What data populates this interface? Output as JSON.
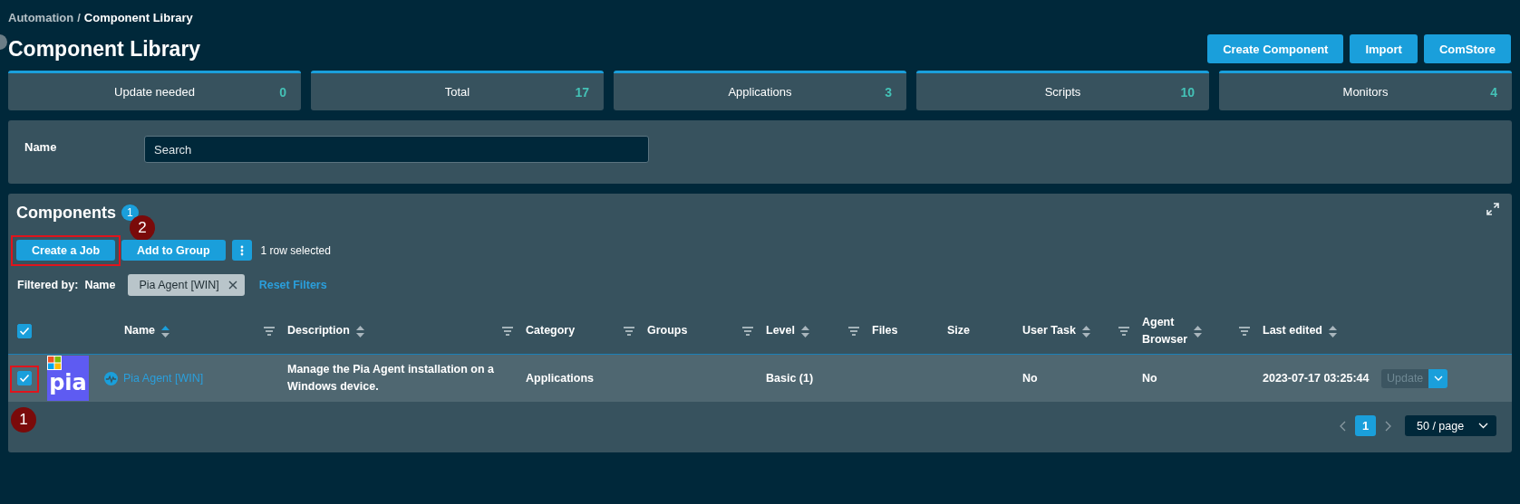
{
  "breadcrumb": {
    "separator": "/",
    "items": [
      {
        "label": "Automation",
        "current": false
      },
      {
        "label": "Component Library",
        "current": true
      }
    ]
  },
  "title": "Component Library",
  "header_buttons": [
    "Create Component",
    "Import",
    "ComStore"
  ],
  "stats": [
    {
      "label": "Update needed",
      "value": "0"
    },
    {
      "label": "Total",
      "value": "17"
    },
    {
      "label": "Applications",
      "value": "3"
    },
    {
      "label": "Scripts",
      "value": "10"
    },
    {
      "label": "Monitors",
      "value": "4"
    }
  ],
  "filter_panel": {
    "label": "Name",
    "field": {
      "placeholder": "Search"
    }
  },
  "components": {
    "title": "Components",
    "count": "1",
    "toolbar": {
      "buttons": [
        {
          "label": "Create a Job",
          "highlighted": true,
          "annotation": "2"
        },
        {
          "label": "Add to Group",
          "highlighted": false
        }
      ],
      "selection": "1 row selected"
    },
    "filters": {
      "label": "Filtered by:",
      "field": "Name",
      "tags": [
        {
          "label": "Pia Agent [WIN]"
        }
      ],
      "reset": "Reset Filters"
    },
    "table": {
      "header_checkbox": {
        "checked": true
      },
      "columns": [
        {
          "label": "Name",
          "sorted": true,
          "filterable": true
        },
        {
          "label": "Description",
          "sorted": false,
          "filterable": true
        },
        {
          "label": "Category",
          "filterable": true
        },
        {
          "label": "Groups",
          "filterable": true
        },
        {
          "label": "Level",
          "sorted": false,
          "filterable": true
        },
        {
          "label": "Files",
          "filterable": false
        },
        {
          "label": "Size",
          "filterable": false
        },
        {
          "label": "User Task",
          "sorted": false,
          "filterable": true
        },
        {
          "label": "Agent Browser",
          "sorted": false,
          "filterable": true
        },
        {
          "label": "Last edited",
          "sorted": false,
          "filterable": false
        }
      ],
      "rows": [
        {
          "checked": true,
          "highlighted": true,
          "annotation": "1",
          "logo_text": "pia",
          "name": "Pia Agent [WIN]",
          "description": "Manage the Pia Agent installation on a Windows device.",
          "category": "Applications",
          "level": "Basic (1)",
          "user_task": "No",
          "agent_browser": "No",
          "last_edited": "2023-07-17 03:25:44",
          "action": {
            "label": "Update",
            "disabled": true
          }
        }
      ]
    },
    "pagination": {
      "pages": [
        {
          "label": "1",
          "selected": true
        }
      ],
      "page_size": "50 / page"
    }
  }
}
